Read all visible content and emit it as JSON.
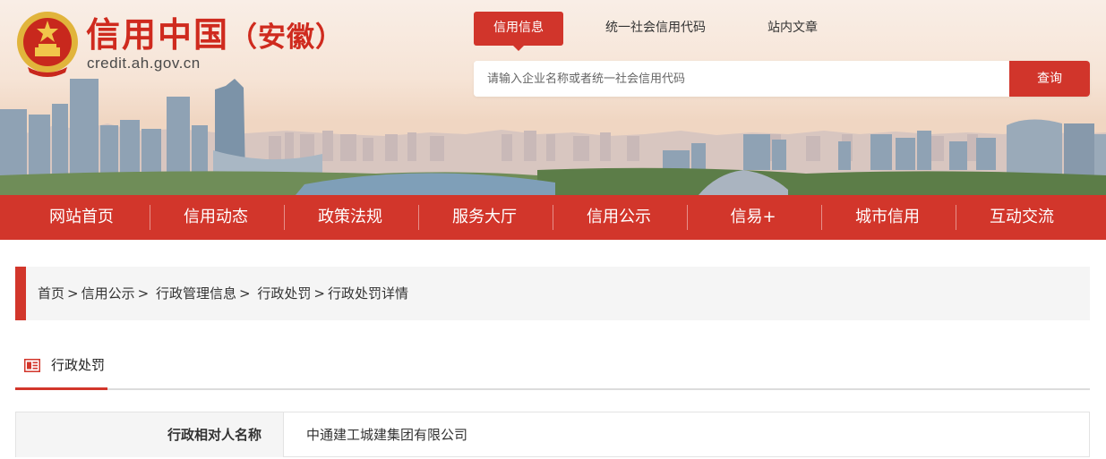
{
  "header": {
    "site_title": "信用中国",
    "region": "（安徽）",
    "domain": "credit.ah.gov.cn",
    "brand_color": "#d1352b",
    "top_tabs": [
      {
        "label": "信用信息",
        "active": true
      },
      {
        "label": "统一社会信用代码",
        "active": false
      },
      {
        "label": "站内文章",
        "active": false
      }
    ],
    "search": {
      "placeholder": "请输入企业名称或者统一社会信用代码",
      "value": "",
      "button_label": "查询"
    }
  },
  "nav": {
    "items": [
      {
        "label": "网站首页"
      },
      {
        "label": "信用动态"
      },
      {
        "label": "政策法规"
      },
      {
        "label": "服务大厅"
      },
      {
        "label": "信用公示"
      },
      {
        "label": "信易+"
      },
      {
        "label": "城市信用"
      },
      {
        "label": "互动交流"
      }
    ]
  },
  "breadcrumb": {
    "items": [
      "首页",
      "信用公示",
      "行政管理信息",
      "行政处罚",
      "行政处罚详情"
    ],
    "separator": ">"
  },
  "section": {
    "tab_label": "行政处罚",
    "icon": "document-list-icon"
  },
  "detail": {
    "rows": [
      {
        "key": "行政相对人名称",
        "value": "中通建工城建集团有限公司"
      }
    ]
  }
}
